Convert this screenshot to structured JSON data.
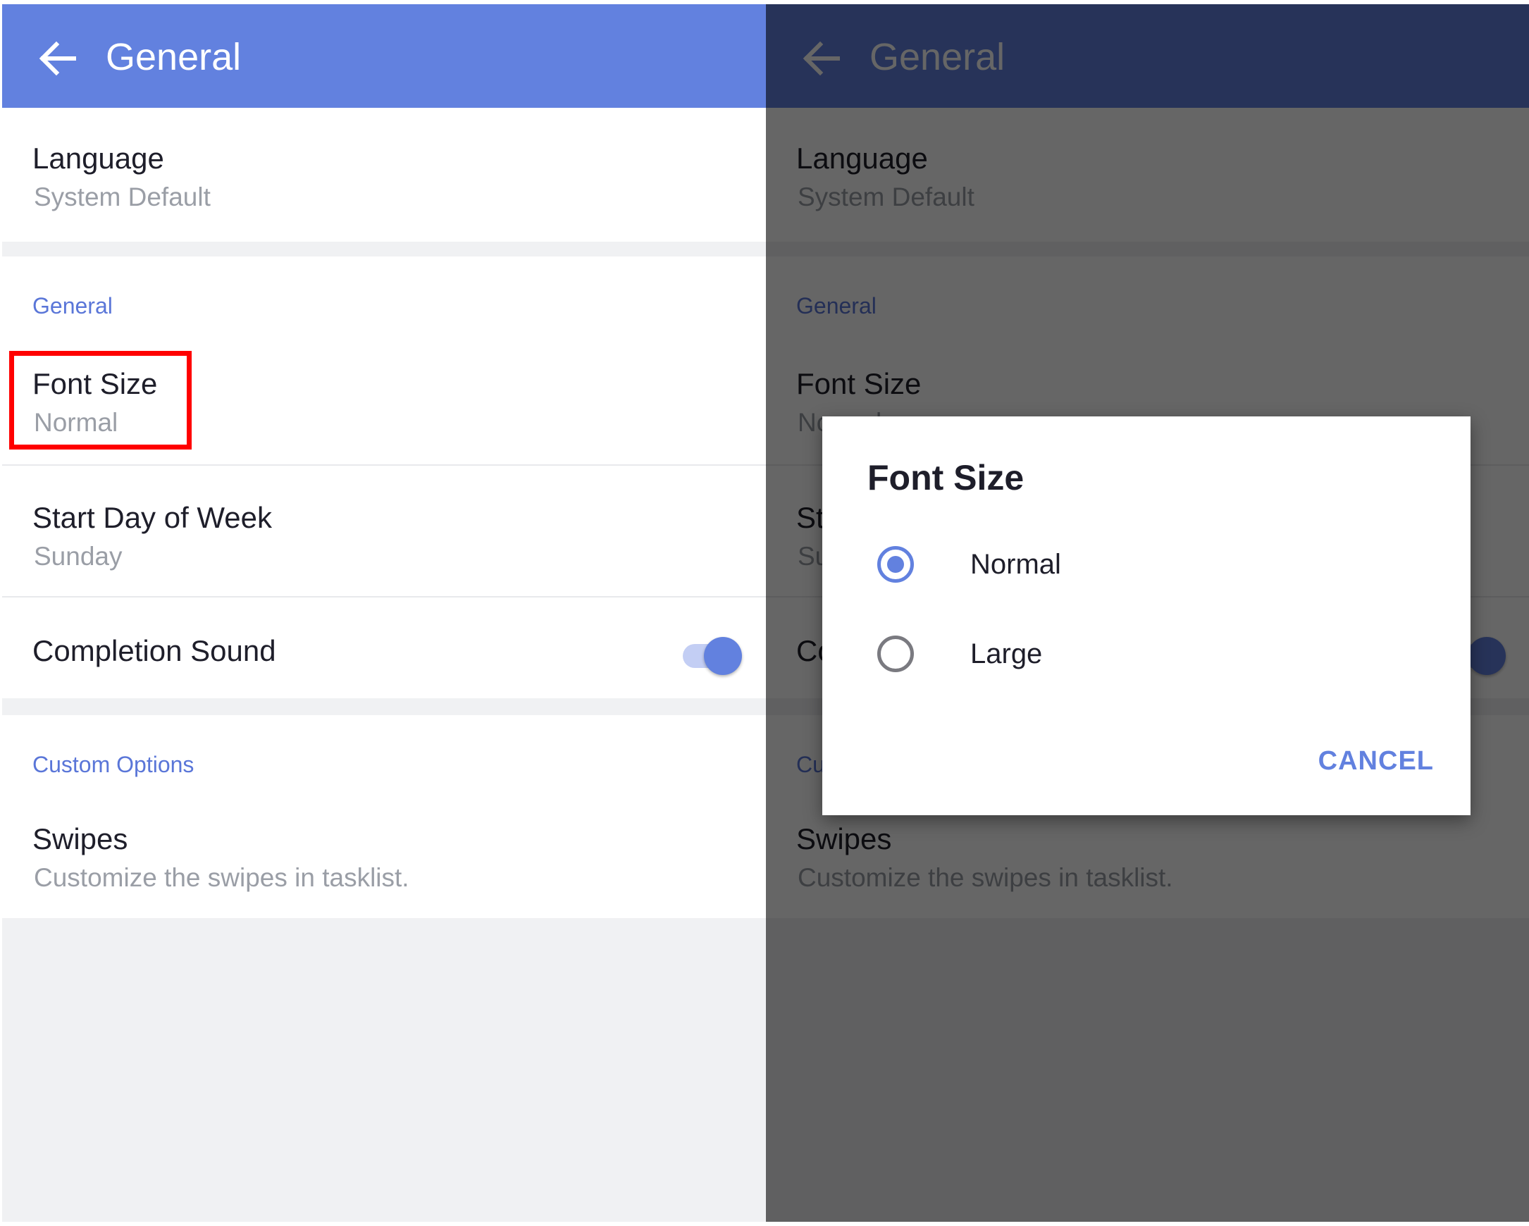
{
  "app_bar": {
    "title": "General"
  },
  "settings": {
    "language": {
      "title": "Language",
      "value": "System Default"
    },
    "general_header": "General",
    "font_size": {
      "title": "Font Size",
      "value": "Normal"
    },
    "start_day": {
      "title": "Start Day of Week",
      "value": "Sunday"
    },
    "completion_sound": {
      "title": "Completion Sound",
      "enabled": true
    },
    "custom_header": "Custom Options",
    "swipes": {
      "title": "Swipes",
      "value": "Customize the swipes in tasklist."
    }
  },
  "dialog": {
    "title": "Font Size",
    "options": [
      {
        "label": "Normal",
        "selected": true
      },
      {
        "label": "Large",
        "selected": false
      }
    ],
    "cancel_label": "CANCEL"
  },
  "colors": {
    "accent": "#6281df",
    "highlight_box": "#ff0000",
    "background": "#f0f1f3"
  },
  "icons": {
    "back": "arrow-left-icon"
  }
}
